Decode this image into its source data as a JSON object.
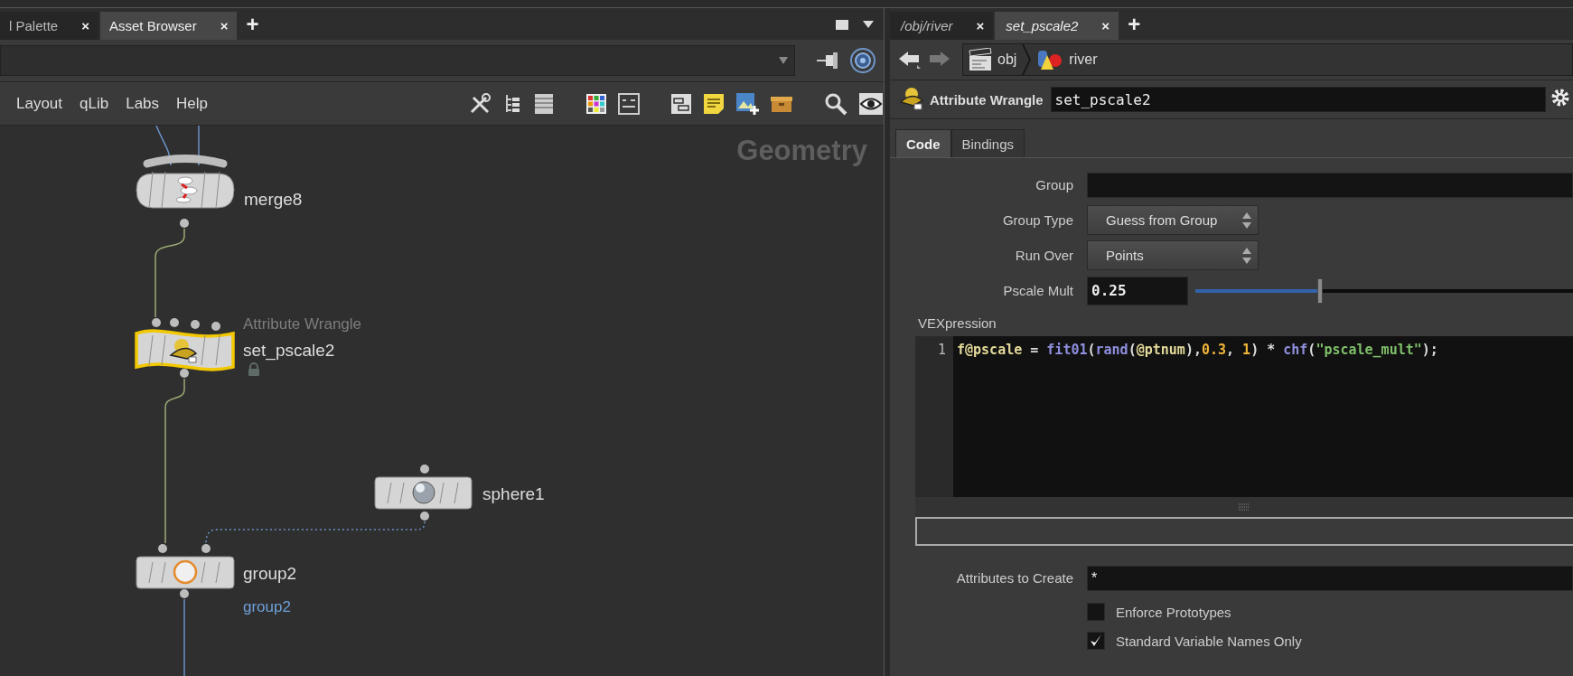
{
  "left_pane": {
    "tabs": [
      {
        "label": "l Palette",
        "close": "×",
        "selected": false
      },
      {
        "label": "Asset Browser",
        "close": "×",
        "selected": true
      }
    ],
    "add_tab": "+",
    "menu": [
      "Layout",
      "qLib",
      "Labs",
      "Help"
    ],
    "network": {
      "title": "Geometry",
      "nodes": [
        {
          "kind": "merge",
          "name": "merge8",
          "selected": false
        },
        {
          "kind": "wrangle",
          "type_label": "Attribute Wrangle",
          "name": "set_pscale2",
          "selected": true,
          "locked": true
        },
        {
          "kind": "sphere",
          "name": "sphere1",
          "selected": false
        },
        {
          "kind": "group",
          "name": "group2",
          "group_label": "group2",
          "selected": false
        }
      ]
    }
  },
  "right_pane": {
    "tabs": [
      {
        "label": "/obj/river",
        "close": "×",
        "selected": false
      },
      {
        "label": "set_pscale2",
        "close": "×",
        "selected": true
      }
    ],
    "add_tab": "+",
    "breadcrumb": [
      "obj",
      "river"
    ],
    "node_type": "Attribute Wrangle",
    "node_name": "set_pscale2",
    "param_tabs": [
      {
        "label": "Code",
        "selected": true
      },
      {
        "label": "Bindings",
        "selected": false
      }
    ],
    "params": [
      {
        "kind": "text",
        "label": "Group"
      },
      {
        "kind": "menu",
        "label": "Group Type",
        "value": "Guess from Group"
      },
      {
        "kind": "menu",
        "label": "Run Over",
        "value": "Points"
      },
      {
        "kind": "slider",
        "label": "Pscale Mult",
        "value": "0.25",
        "level": 0.33
      }
    ],
    "vex": {
      "label": "VEXpression",
      "line_number": "1",
      "tokens": [
        {
          "kind": "var",
          "text": "f@pscale"
        },
        {
          "kind": "plain",
          "text": " = "
        },
        {
          "kind": "func",
          "text": "fit01"
        },
        {
          "kind": "plain",
          "text": "("
        },
        {
          "kind": "func",
          "text": "rand"
        },
        {
          "kind": "plain",
          "text": "("
        },
        {
          "kind": "var",
          "text": "@ptnum"
        },
        {
          "kind": "plain",
          "text": "),"
        },
        {
          "kind": "num",
          "text": "0.3"
        },
        {
          "kind": "plain",
          "text": ", "
        },
        {
          "kind": "num",
          "text": "1"
        },
        {
          "kind": "plain",
          "text": ") * "
        },
        {
          "kind": "func",
          "text": "chf"
        },
        {
          "kind": "plain",
          "text": "("
        },
        {
          "kind": "str",
          "text": "\"pscale_mult\""
        },
        {
          "kind": "plain",
          "text": ");"
        }
      ]
    },
    "attributes": {
      "label": "Attributes to Create",
      "value": "*"
    },
    "checkboxes": [
      {
        "label": "Enforce Prototypes",
        "checked": false
      },
      {
        "label": "Standard Variable Names Only",
        "checked": true
      }
    ]
  }
}
